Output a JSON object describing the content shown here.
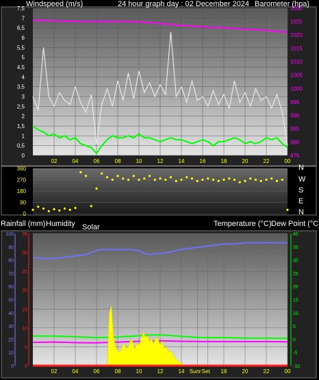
{
  "header": {
    "left": "Windspeed (m/s)",
    "center": "24 hour graph day : 02 December 2024",
    "right": "Barometer (hpa)"
  },
  "panel2": {
    "compass_labels": [
      "N",
      "W",
      "S",
      "E",
      "N"
    ]
  },
  "panel3": {
    "rain_label": "Rainfall (mm)",
    "humidity_label": "Humidity",
    "solar_label": "Solar",
    "temp_label": "Temperature (°C)",
    "dew_label": "Dew Point (°C)",
    "sunrise_label": "Sunr",
    "sunset_label": "Set"
  },
  "colors": {
    "wind_avg": "#00ff00",
    "gust": "#e8e8e8",
    "barometer": "#ff00ff",
    "wind_dir": "#ffff00",
    "temperature": "#00ff00",
    "dewpoint": "#ff00ff",
    "humidity": "#7070ff",
    "solar": "#ffff00",
    "rain": "#ff2020",
    "axis_x": "#ffff00",
    "axis_baro": "#ff00ff",
    "axis_temp": "#00ff00",
    "axis_hum": "#8080ff",
    "axis_rain": "#ff2020"
  },
  "chart_data": [
    {
      "type": "line",
      "title": "24 hour graph day : 02 December 2024",
      "ylabel": "Windspeed (m/s)",
      "y2label": "Barometer (hpa)",
      "x_ticks": [
        "02",
        "04",
        "06",
        "08",
        "10",
        "12",
        "14",
        "16",
        "18",
        "20",
        "22",
        "00"
      ],
      "y_ticks": [
        "0",
        "0,5",
        "1",
        "1,5",
        "2",
        "2,5",
        "3",
        "3,5",
        "4",
        "4,5",
        "5",
        "5,5",
        "6",
        "6,5",
        "7",
        "7,5"
      ],
      "y_range": [
        0,
        7.5
      ],
      "y2_ticks": [
        "975",
        "980",
        "985",
        "990",
        "995",
        "1000",
        "1005",
        "1010",
        "1015",
        "1020",
        "1025",
        "1030"
      ],
      "y2_range": [
        975,
        1030
      ],
      "series": [
        {
          "key": "gust",
          "x": [
            0,
            0.5,
            1,
            1.5,
            2,
            2.5,
            3,
            3.5,
            4,
            4.5,
            5,
            5.5,
            6,
            6.5,
            7,
            7.5,
            8,
            8.5,
            9,
            9.5,
            10,
            10.5,
            11,
            11.5,
            12,
            12.5,
            13,
            13.5,
            14,
            14.5,
            15,
            15.5,
            16,
            16.5,
            17,
            17.5,
            18,
            18.5,
            19,
            19.5,
            20,
            20.5,
            21,
            21.5,
            22,
            22.5,
            23,
            23.5,
            24
          ],
          "values": [
            3.0,
            2.3,
            5.5,
            3.0,
            2.5,
            3.2,
            2.8,
            2.6,
            3.5,
            2.7,
            2.2,
            3.1,
            0.6,
            2.6,
            3.4,
            2.5,
            3.8,
            2.8,
            4.2,
            2.9,
            4.3,
            3.2,
            3.7,
            3.0,
            3.6,
            3.1,
            6.3,
            3.0,
            3.5,
            2.7,
            3.8,
            2.8,
            3.0,
            2.5,
            3.3,
            2.6,
            3.1,
            2.4,
            3.8,
            2.7,
            3.2,
            2.5,
            3.4,
            2.8,
            3.0,
            2.4,
            3.1,
            2.2,
            0.5
          ]
        },
        {
          "key": "wind_avg",
          "x": [
            0,
            0.5,
            1,
            1.5,
            2,
            2.5,
            3,
            3.5,
            4,
            4.5,
            5,
            5.5,
            6,
            6.5,
            7,
            7.5,
            8,
            8.5,
            9,
            9.5,
            10,
            10.5,
            11,
            11.5,
            12,
            12.5,
            13,
            13.5,
            14,
            14.5,
            15,
            15.5,
            16,
            16.5,
            17,
            17.5,
            18,
            18.5,
            19,
            19.5,
            20,
            20.5,
            21,
            21.5,
            22,
            22.5,
            23,
            23.5,
            24
          ],
          "values": [
            1.5,
            1.3,
            1.2,
            1.0,
            1.1,
            0.9,
            1.0,
            0.8,
            0.9,
            0.6,
            0.5,
            0.4,
            0.1,
            0.5,
            0.8,
            1.0,
            0.9,
            0.9,
            1.0,
            0.9,
            1.1,
            0.9,
            0.9,
            0.8,
            0.7,
            0.8,
            0.9,
            0.8,
            0.8,
            0.7,
            0.6,
            0.7,
            0.8,
            0.7,
            0.5,
            0.7,
            0.7,
            0.8,
            0.9,
            0.8,
            0.6,
            0.7,
            0.6,
            0.7,
            0.9,
            0.8,
            0.9,
            0.6,
            0.4
          ]
        },
        {
          "key": "barometer",
          "axis": "right",
          "x": [
            0,
            2,
            4,
            6,
            8,
            10,
            12,
            14,
            16,
            18,
            20,
            22,
            24
          ],
          "values": [
            1025.6,
            1025.3,
            1025.1,
            1025.0,
            1025.1,
            1024.9,
            1024.3,
            1023.6,
            1023.0,
            1022.7,
            1022.2,
            1021.8,
            1021.0
          ]
        }
      ]
    },
    {
      "type": "scatter",
      "ylabel": "Wind direction",
      "y_ticks": [
        "0",
        "90",
        "180",
        "270",
        "360"
      ],
      "y_range": [
        0,
        360
      ],
      "series": [
        {
          "key": "wind_dir",
          "x": [
            0,
            0.5,
            1,
            1.5,
            2,
            2.5,
            3,
            3.5,
            4,
            4.5,
            5,
            5.5,
            6,
            6.5,
            7,
            7.5,
            8,
            8.5,
            9,
            9.5,
            10,
            10.5,
            11,
            11.5,
            12,
            12.5,
            13,
            13.5,
            14,
            14.5,
            15,
            15.5,
            16,
            16.5,
            17,
            17.5,
            18,
            18.5,
            19,
            19.5,
            20,
            20.5,
            21,
            21.5,
            22,
            22.5,
            23,
            23.5,
            24
          ],
          "values": [
            30,
            55,
            40,
            20,
            35,
            25,
            40,
            30,
            45,
            330,
            300,
            60,
            200,
            320,
            290,
            270,
            300,
            280,
            270,
            300,
            270,
            280,
            300,
            270,
            280,
            270,
            290,
            260,
            270,
            290,
            280,
            260,
            270,
            280,
            270,
            260,
            270,
            280,
            270,
            250,
            260,
            280,
            270,
            260,
            270,
            280,
            260,
            270,
            30
          ]
        }
      ]
    },
    {
      "type": "line",
      "ylabel": "Rainfall (mm)",
      "x_ticks": [
        "02",
        "04",
        "06",
        "08",
        "10",
        "12",
        "14",
        "Sunr",
        "Set",
        "16",
        "18",
        "20",
        "22",
        "00"
      ],
      "rain_ticks": [
        "0",
        "5",
        "10",
        "15",
        "20",
        "25",
        "30",
        "35"
      ],
      "rain_range": [
        0,
        35
      ],
      "hum_ticks": [
        "0",
        "10",
        "20",
        "30",
        "40",
        "50",
        "60",
        "70",
        "80",
        "90",
        "100"
      ],
      "hum_range": [
        0,
        100
      ],
      "temp_ticks": [
        "-10",
        "-5",
        "0",
        "5",
        "10",
        "15",
        "20",
        "25",
        "30",
        "35",
        "40"
      ],
      "temp_range": [
        -10,
        40
      ],
      "series": [
        {
          "key": "humidity",
          "axis": "humidity",
          "x": [
            0,
            1,
            2,
            3,
            4,
            5,
            6,
            6.5,
            7,
            8,
            9,
            10,
            10.5,
            11,
            11.5,
            12,
            13,
            14,
            15,
            16,
            17,
            18,
            19,
            20,
            21,
            22,
            23,
            24
          ],
          "values": [
            82,
            81,
            81,
            82,
            83,
            84,
            87,
            88,
            88,
            88,
            88,
            87,
            85,
            84,
            85,
            85,
            86,
            88,
            89,
            90,
            91,
            92,
            92,
            93,
            93,
            93,
            93,
            93
          ]
        },
        {
          "key": "temperature",
          "axis": "temp",
          "x": [
            0,
            2,
            4,
            6,
            8,
            10,
            11,
            12,
            13,
            14,
            16,
            18,
            20,
            22,
            24
          ],
          "values": [
            1.2,
            1.2,
            0.9,
            0.6,
            0.8,
            1.3,
            1.6,
            1.6,
            1.4,
            1.1,
            0.6,
            0.6,
            0.4,
            0.4,
            0.3
          ]
        },
        {
          "key": "dewpoint",
          "axis": "temp",
          "x": [
            0,
            2,
            4,
            6,
            8,
            10,
            12,
            14,
            16,
            18,
            20,
            22,
            24
          ],
          "values": [
            -1.2,
            -1.1,
            -1.3,
            -1.4,
            -1.1,
            -0.8,
            -0.6,
            -0.8,
            -0.9,
            -0.9,
            -0.9,
            -0.9,
            -1.0
          ]
        },
        {
          "key": "solar",
          "axis": "rain",
          "x": [
            7.0,
            7.2,
            7.4,
            7.6,
            7.8,
            8.0,
            8.2,
            8.4,
            8.6,
            8.8,
            9.0,
            9.2,
            9.4,
            9.6,
            9.8,
            10.0,
            10.2,
            10.4,
            10.6,
            10.8,
            11.0,
            11.2,
            11.4,
            11.6,
            11.8,
            12.0,
            12.2,
            12.4,
            12.6,
            12.8,
            13.0,
            13.2,
            13.4,
            13.6,
            13.8,
            14.0,
            14.2,
            14.4
          ],
          "values": [
            0,
            14,
            16,
            8,
            5,
            4,
            3.5,
            5,
            6,
            4.5,
            5,
            7,
            6.5,
            4.5,
            6,
            5.5,
            7,
            9,
            7.5,
            8,
            6.5,
            7,
            6,
            7.5,
            7,
            5.5,
            6.5,
            4.5,
            5,
            3.5,
            4,
            3,
            2,
            1.5,
            1,
            0.6,
            0.3,
            0
          ]
        },
        {
          "key": "rain",
          "axis": "rain",
          "x": [
            0,
            24
          ],
          "values": [
            0,
            0
          ]
        }
      ]
    }
  ]
}
